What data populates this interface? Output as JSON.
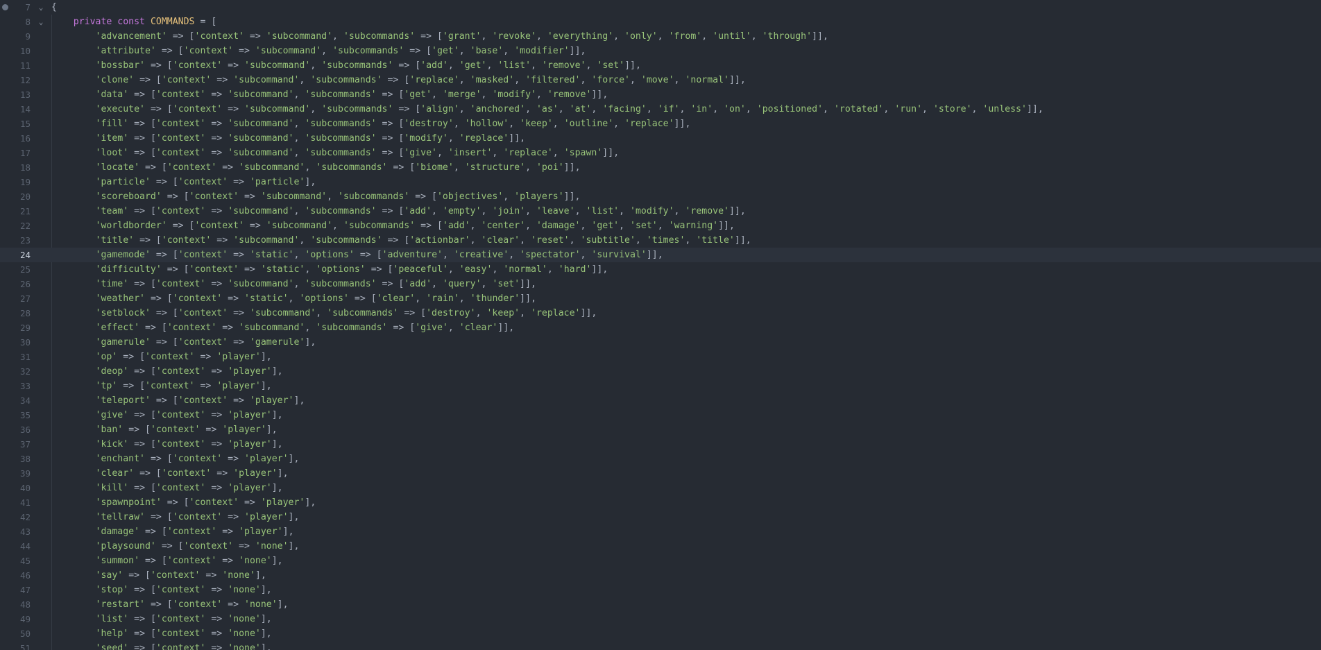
{
  "editor": {
    "current_line": 24,
    "lines": [
      {
        "n": 7,
        "code": "{",
        "fold": true,
        "marker": true
      },
      {
        "n": 8,
        "code": "    private const COMMANDS = [",
        "fold": true
      },
      {
        "n": 9,
        "code": "        'advancement' => ['context' => 'subcommand', 'subcommands' => ['grant', 'revoke', 'everything', 'only', 'from', 'until', 'through']],"
      },
      {
        "n": 10,
        "code": "        'attribute' => ['context' => 'subcommand', 'subcommands' => ['get', 'base', 'modifier']],"
      },
      {
        "n": 11,
        "code": "        'bossbar' => ['context' => 'subcommand', 'subcommands' => ['add', 'get', 'list', 'remove', 'set']],"
      },
      {
        "n": 12,
        "code": "        'clone' => ['context' => 'subcommand', 'subcommands' => ['replace', 'masked', 'filtered', 'force', 'move', 'normal']],"
      },
      {
        "n": 13,
        "code": "        'data' => ['context' => 'subcommand', 'subcommands' => ['get', 'merge', 'modify', 'remove']],"
      },
      {
        "n": 14,
        "code": "        'execute' => ['context' => 'subcommand', 'subcommands' => ['align', 'anchored', 'as', 'at', 'facing', 'if', 'in', 'on', 'positioned', 'rotated', 'run', 'store', 'unless']],"
      },
      {
        "n": 15,
        "code": "        'fill' => ['context' => 'subcommand', 'subcommands' => ['destroy', 'hollow', 'keep', 'outline', 'replace']],"
      },
      {
        "n": 16,
        "code": "        'item' => ['context' => 'subcommand', 'subcommands' => ['modify', 'replace']],"
      },
      {
        "n": 17,
        "code": "        'loot' => ['context' => 'subcommand', 'subcommands' => ['give', 'insert', 'replace', 'spawn']],"
      },
      {
        "n": 18,
        "code": "        'locate' => ['context' => 'subcommand', 'subcommands' => ['biome', 'structure', 'poi']],"
      },
      {
        "n": 19,
        "code": "        'particle' => ['context' => 'particle'],"
      },
      {
        "n": 20,
        "code": "        'scoreboard' => ['context' => 'subcommand', 'subcommands' => ['objectives', 'players']],"
      },
      {
        "n": 21,
        "code": "        'team' => ['context' => 'subcommand', 'subcommands' => ['add', 'empty', 'join', 'leave', 'list', 'modify', 'remove']],"
      },
      {
        "n": 22,
        "code": "        'worldborder' => ['context' => 'subcommand', 'subcommands' => ['add', 'center', 'damage', 'get', 'set', 'warning']],"
      },
      {
        "n": 23,
        "code": "        'title' => ['context' => 'subcommand', 'subcommands' => ['actionbar', 'clear', 'reset', 'subtitle', 'times', 'title']],"
      },
      {
        "n": 24,
        "code": "        'gamemode' => ['context' => 'static', 'options' => ['adventure', 'creative', 'spectator', 'survival']],"
      },
      {
        "n": 25,
        "code": "        'difficulty' => ['context' => 'static', 'options' => ['peaceful', 'easy', 'normal', 'hard']],"
      },
      {
        "n": 26,
        "code": "        'time' => ['context' => 'subcommand', 'subcommands' => ['add', 'query', 'set']],"
      },
      {
        "n": 27,
        "code": "        'weather' => ['context' => 'static', 'options' => ['clear', 'rain', 'thunder']],"
      },
      {
        "n": 28,
        "code": "        'setblock' => ['context' => 'subcommand', 'subcommands' => ['destroy', 'keep', 'replace']],"
      },
      {
        "n": 29,
        "code": "        'effect' => ['context' => 'subcommand', 'subcommands' => ['give', 'clear']],"
      },
      {
        "n": 30,
        "code": "        'gamerule' => ['context' => 'gamerule'],"
      },
      {
        "n": 31,
        "code": "        'op' => ['context' => 'player'],"
      },
      {
        "n": 32,
        "code": "        'deop' => ['context' => 'player'],"
      },
      {
        "n": 33,
        "code": "        'tp' => ['context' => 'player'],"
      },
      {
        "n": 34,
        "code": "        'teleport' => ['context' => 'player'],"
      },
      {
        "n": 35,
        "code": "        'give' => ['context' => 'player'],"
      },
      {
        "n": 36,
        "code": "        'ban' => ['context' => 'player'],"
      },
      {
        "n": 37,
        "code": "        'kick' => ['context' => 'player'],"
      },
      {
        "n": 38,
        "code": "        'enchant' => ['context' => 'player'],"
      },
      {
        "n": 39,
        "code": "        'clear' => ['context' => 'player'],"
      },
      {
        "n": 40,
        "code": "        'kill' => ['context' => 'player'],"
      },
      {
        "n": 41,
        "code": "        'spawnpoint' => ['context' => 'player'],"
      },
      {
        "n": 42,
        "code": "        'tellraw' => ['context' => 'player'],"
      },
      {
        "n": 43,
        "code": "        'damage' => ['context' => 'player'],"
      },
      {
        "n": 44,
        "code": "        'playsound' => ['context' => 'none'],"
      },
      {
        "n": 45,
        "code": "        'summon' => ['context' => 'none'],"
      },
      {
        "n": 46,
        "code": "        'say' => ['context' => 'none'],"
      },
      {
        "n": 47,
        "code": "        'stop' => ['context' => 'none'],"
      },
      {
        "n": 48,
        "code": "        'restart' => ['context' => 'none'],"
      },
      {
        "n": 49,
        "code": "        'list' => ['context' => 'none'],"
      },
      {
        "n": 50,
        "code": "        'help' => ['context' => 'none'],"
      },
      {
        "n": 51,
        "code": "        'seed' => ['context' => 'none'],"
      }
    ]
  }
}
